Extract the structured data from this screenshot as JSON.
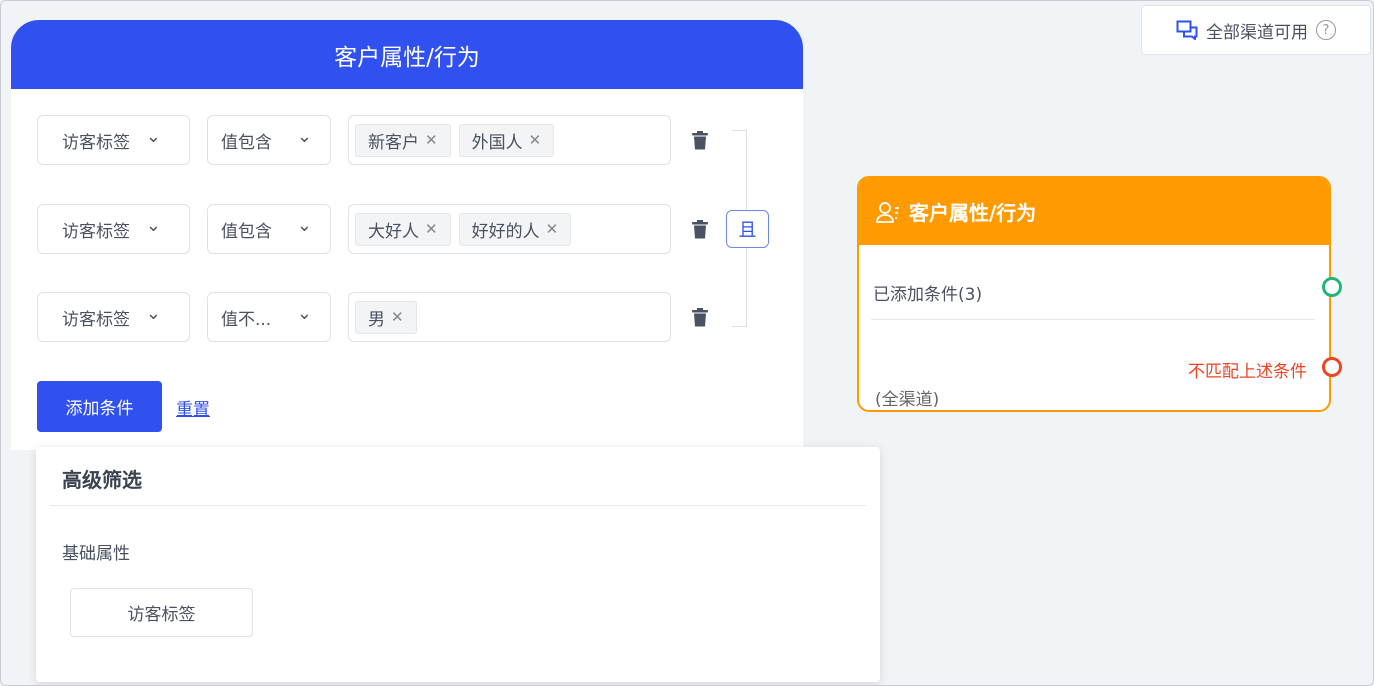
{
  "panel": {
    "title": "客户属性/行为",
    "rows": [
      {
        "field": "访客标签",
        "op": "值包含",
        "tags": [
          "新客户",
          "外国人"
        ]
      },
      {
        "field": "访客标签",
        "op": "值包含",
        "tags": [
          "大好人",
          "好好的人"
        ]
      },
      {
        "field": "访客标签",
        "op": "值不...",
        "tags": [
          "男"
        ]
      }
    ],
    "logic": "且",
    "add_label": "添加条件",
    "reset_label": "重置"
  },
  "popover": {
    "title": "高级筛选",
    "section": "基础属性",
    "option": "访客标签"
  },
  "top_button": {
    "label": "全部渠道可用"
  },
  "node": {
    "title": "客户属性/行为",
    "conditions": "已添加条件(3)",
    "no_match": "不匹配上述条件",
    "channel": "(全渠道)"
  },
  "colors": {
    "primary": "#3050f0",
    "node": "#ff9a00",
    "success": "#22b573",
    "danger": "#ee4422"
  }
}
